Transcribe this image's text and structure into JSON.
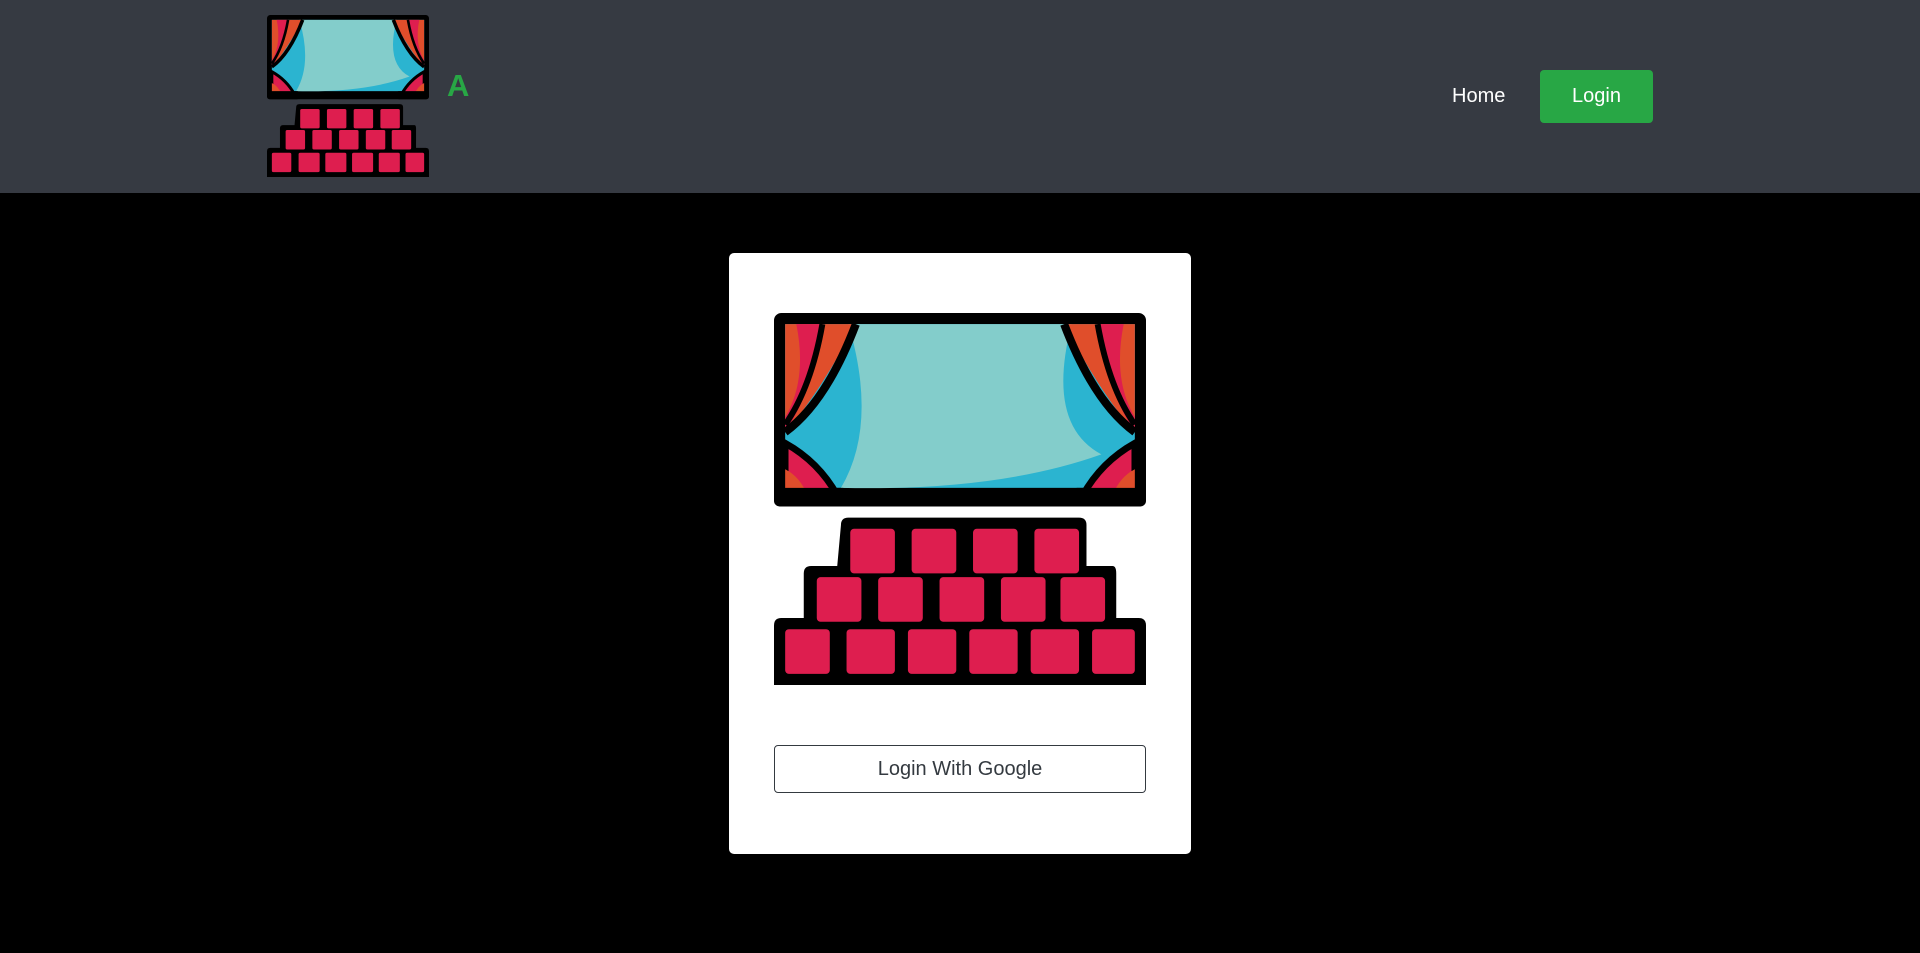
{
  "navbar": {
    "brand_text": "A",
    "home_label": "Home",
    "login_label": "Login"
  },
  "login_card": {
    "google_button_label": "Login With Google"
  },
  "colors": {
    "navbar_bg": "#363a42",
    "brand_green": "#28a745",
    "page_bg": "#000000",
    "screen_blue": "#2bb4d0",
    "screen_light": "#83cdcb",
    "curtain_orange": "#e04e2b",
    "curtain_red": "#de1e4f",
    "seat_red": "#de1e4f"
  },
  "icons": {
    "brand_logo": "theater-stage-icon",
    "card_logo": "theater-stage-icon"
  }
}
